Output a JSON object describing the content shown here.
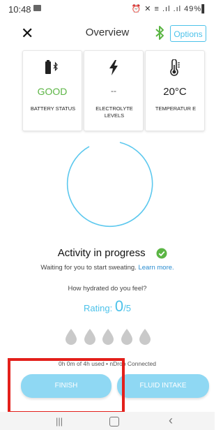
{
  "status_bar": {
    "time": "10:48",
    "right": "⏰ ✕ ≡ .ıl .ıl 49%▌"
  },
  "header": {
    "close_icon": "✕",
    "title": "Overview",
    "options_label": "Options"
  },
  "cards": {
    "battery": {
      "value": "GOOD",
      "label": "BATTERY STATUS"
    },
    "electrolyte": {
      "value": "--",
      "label": "ELECTROLYTE LEVELS"
    },
    "temperature": {
      "value": "20°C",
      "label": "TEMPERATUR E"
    }
  },
  "activity": {
    "title": "Activity in progress",
    "subtitle": "Waiting for you to start sweating.",
    "learn_more": "Learn more."
  },
  "hydration": {
    "question": "How hydrated do you feel?",
    "rating_label": "Rating:",
    "rating_value": "0",
    "rating_max": "/5"
  },
  "usage_text": "0h 0m of 4h used  •  nDrop Connected",
  "buttons": {
    "finish": "FINISH",
    "fluid_intake": "FLUID INTAKE"
  },
  "nav": {
    "recents": "|||",
    "back": "‹"
  },
  "colors": {
    "accent": "#4cc2ea",
    "good": "#5bb544",
    "button": "#8fd8f3",
    "highlight": "#e3201b",
    "bluetooth": "#5bb544",
    "drop": "#c9c9c9"
  },
  "icons": [
    "battery-bluetooth-icon",
    "lightning-icon",
    "thermometer-icon",
    "bluetooth-icon",
    "check-circle-icon",
    "drop-icon"
  ]
}
